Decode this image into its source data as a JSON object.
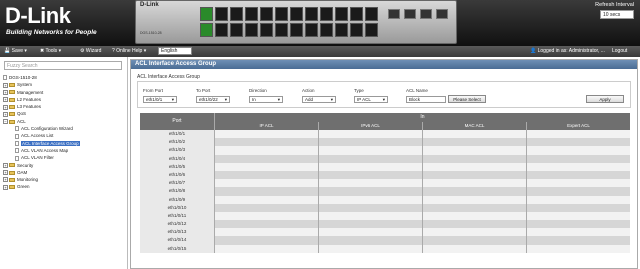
{
  "header": {
    "logo": "D-Link",
    "tagline": "Building Networks for People",
    "device_brand": "D-Link",
    "device_model": "DGS-1510-28",
    "refresh_label": "Refresh Interval",
    "refresh_value": "10 secs"
  },
  "toolbar": {
    "save": "Save",
    "tools": "Tools",
    "wizard": "Wizard",
    "online_help": "Online Help",
    "language": "English",
    "logged_in": "Logged in as: Administrator, ...",
    "logout": "Logout"
  },
  "sidebar": {
    "search_placeholder": "Fuzzy Search",
    "items": [
      {
        "label": "DGS-1510-28",
        "type": "page",
        "level": 0
      },
      {
        "label": "System",
        "type": "folder",
        "level": 0
      },
      {
        "label": "Management",
        "type": "folder",
        "level": 0
      },
      {
        "label": "L2 Features",
        "type": "folder",
        "level": 0
      },
      {
        "label": "L3 Features",
        "type": "folder",
        "level": 0
      },
      {
        "label": "QoS",
        "type": "folder",
        "level": 0
      },
      {
        "label": "ACL",
        "type": "folder-open",
        "level": 0
      },
      {
        "label": "ACL Configuration Wizard",
        "type": "page",
        "level": 1
      },
      {
        "label": "ACL Access List",
        "type": "page",
        "level": 1
      },
      {
        "label": "ACL Interface Access Group",
        "type": "page",
        "level": 1,
        "selected": true
      },
      {
        "label": "ACL VLAN Access Map",
        "type": "page",
        "level": 1
      },
      {
        "label": "ACL VLAN Filter",
        "type": "page",
        "level": 1
      },
      {
        "label": "Security",
        "type": "folder",
        "level": 0
      },
      {
        "label": "OAM",
        "type": "folder",
        "level": 0
      },
      {
        "label": "Monitoring",
        "type": "folder",
        "level": 0
      },
      {
        "label": "Green",
        "type": "folder",
        "level": 0
      }
    ]
  },
  "main": {
    "title": "ACL Interface Access Group",
    "section_title": "ACL Interface Access Group",
    "form": {
      "from_port_label": "From Port",
      "from_port_value": "eth1/0/1",
      "to_port_label": "To Port",
      "to_port_value": "eth1/0/22",
      "direction_label": "Direction",
      "direction_value": "In",
      "action_label": "Action",
      "action_value": "Add",
      "type_label": "Type",
      "type_value": "IP ACL",
      "acl_name_label": "ACL Name",
      "acl_name_value": "Block",
      "please_select": "Please Select",
      "apply": "Apply"
    },
    "table": {
      "port_header": "Port",
      "group_header": "In",
      "col_ip": "IP ACL",
      "col_ipv6": "IPv6 ACL",
      "col_mac": "MAC ACL",
      "col_expert": "Expert ACL",
      "rows": [
        "eth1/0/1",
        "eth1/0/2",
        "eth1/0/3",
        "eth1/0/4",
        "eth1/0/5",
        "eth1/0/6",
        "eth1/0/7",
        "eth1/0/8",
        "eth1/0/9",
        "eth1/0/10",
        "eth1/0/11",
        "eth1/0/12",
        "eth1/0/13",
        "eth1/0/14",
        "eth1/0/15"
      ]
    }
  }
}
